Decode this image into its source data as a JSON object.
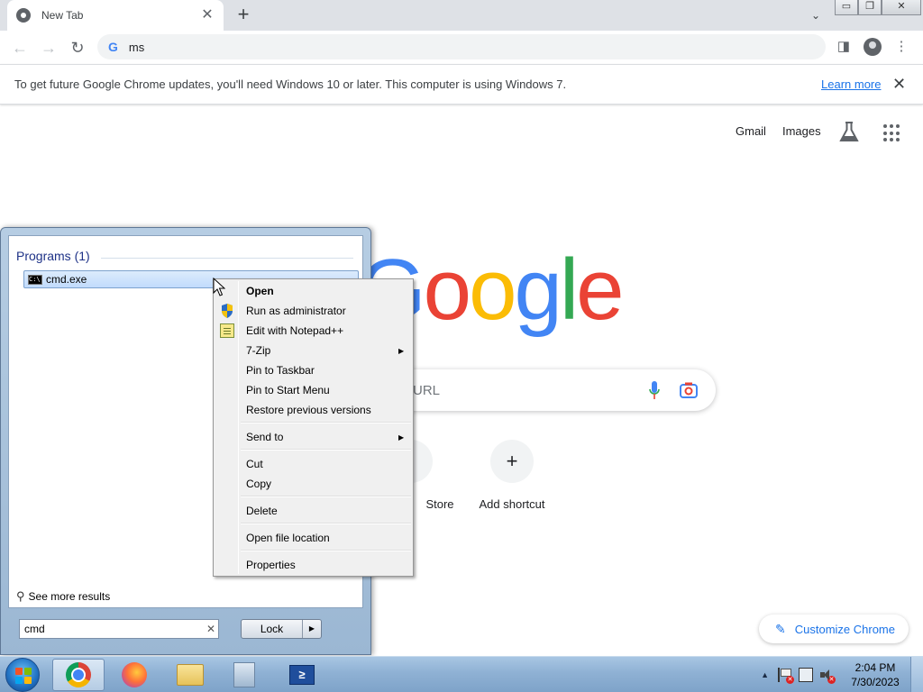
{
  "browser": {
    "tab": {
      "title": "New Tab",
      "close": "✕"
    },
    "new_tab": "+",
    "tab_search": "⌄",
    "window_controls": {
      "minimize": "▭",
      "restore": "❐",
      "close": "✕"
    },
    "nav": {
      "back": "←",
      "forward": "→",
      "reload": "↻"
    },
    "omnibox": {
      "value": "ms",
      "google_glyph": "G"
    },
    "toolbar_right": {
      "side_panel": "◨",
      "menu": "⋮"
    },
    "infobar": {
      "message": "To get future Google Chrome updates, you'll need Windows 10 or later. This computer is using Windows 7.",
      "link": "Learn more",
      "close": "✕"
    }
  },
  "ntp": {
    "links": [
      "Gmail",
      "Images"
    ],
    "logo_letters": [
      {
        "ch": "G",
        "color": "#4285F4"
      },
      {
        "ch": "o",
        "color": "#EA4335"
      },
      {
        "ch": "o",
        "color": "#FBBC05"
      },
      {
        "ch": "g",
        "color": "#4285F4"
      },
      {
        "ch": "l",
        "color": "#34A853"
      },
      {
        "ch": "e",
        "color": "#EA4335"
      }
    ],
    "search_placeholder": "URL",
    "shortcuts": [
      {
        "label": "Store",
        "glyph": ""
      },
      {
        "label": "Add shortcut",
        "glyph": "+"
      }
    ],
    "customize": {
      "label": "Customize Chrome",
      "icon": "✎"
    }
  },
  "start_menu": {
    "heading": "Programs (1)",
    "result": {
      "name": "cmd.exe",
      "icon_text": "C:\\"
    },
    "see_more": {
      "label": "See more results",
      "icon": "⚲"
    },
    "search_value": "cmd",
    "clear": "✕",
    "power_button": {
      "label": "Lock",
      "arrow": "▶"
    }
  },
  "context_menu": {
    "items": [
      {
        "label": "Open",
        "bold": true,
        "icon": "",
        "submenu": ""
      },
      {
        "label": "Run as administrator",
        "bold": false,
        "icon": "shield",
        "submenu": ""
      },
      {
        "label": "Edit with Notepad++",
        "bold": false,
        "icon": "notepad",
        "submenu": ""
      },
      {
        "label": "7-Zip",
        "bold": false,
        "icon": "",
        "submenu": "▶"
      },
      {
        "label": "Pin to Taskbar",
        "bold": false,
        "icon": "",
        "submenu": ""
      },
      {
        "label": "Pin to Start Menu",
        "bold": false,
        "icon": "",
        "submenu": ""
      },
      {
        "label": "Restore previous versions",
        "bold": false,
        "icon": "",
        "submenu": ""
      },
      {
        "label": "Send to",
        "bold": false,
        "icon": "",
        "submenu": "▶"
      },
      {
        "label": "Cut",
        "bold": false,
        "icon": "",
        "submenu": ""
      },
      {
        "label": "Copy",
        "bold": false,
        "icon": "",
        "submenu": ""
      },
      {
        "label": "Delete",
        "bold": false,
        "icon": "",
        "submenu": ""
      },
      {
        "label": "Open file location",
        "bold": false,
        "icon": "",
        "submenu": ""
      },
      {
        "label": "Properties",
        "bold": false,
        "icon": "",
        "submenu": ""
      }
    ]
  },
  "taskbar": {
    "apps": [
      "chrome-icon",
      "firefox-icon",
      "file-explorer-icon",
      "document-icon",
      "powershell-icon"
    ],
    "active_app": "chrome-icon",
    "powershell_glyph": "≥",
    "tray": {
      "show_hidden": "▲",
      "time": "2:04 PM",
      "date": "7/30/2023"
    },
    "orb_colors": [
      "#f35325",
      "#81bc06",
      "#05a6f0",
      "#ffba08"
    ]
  }
}
